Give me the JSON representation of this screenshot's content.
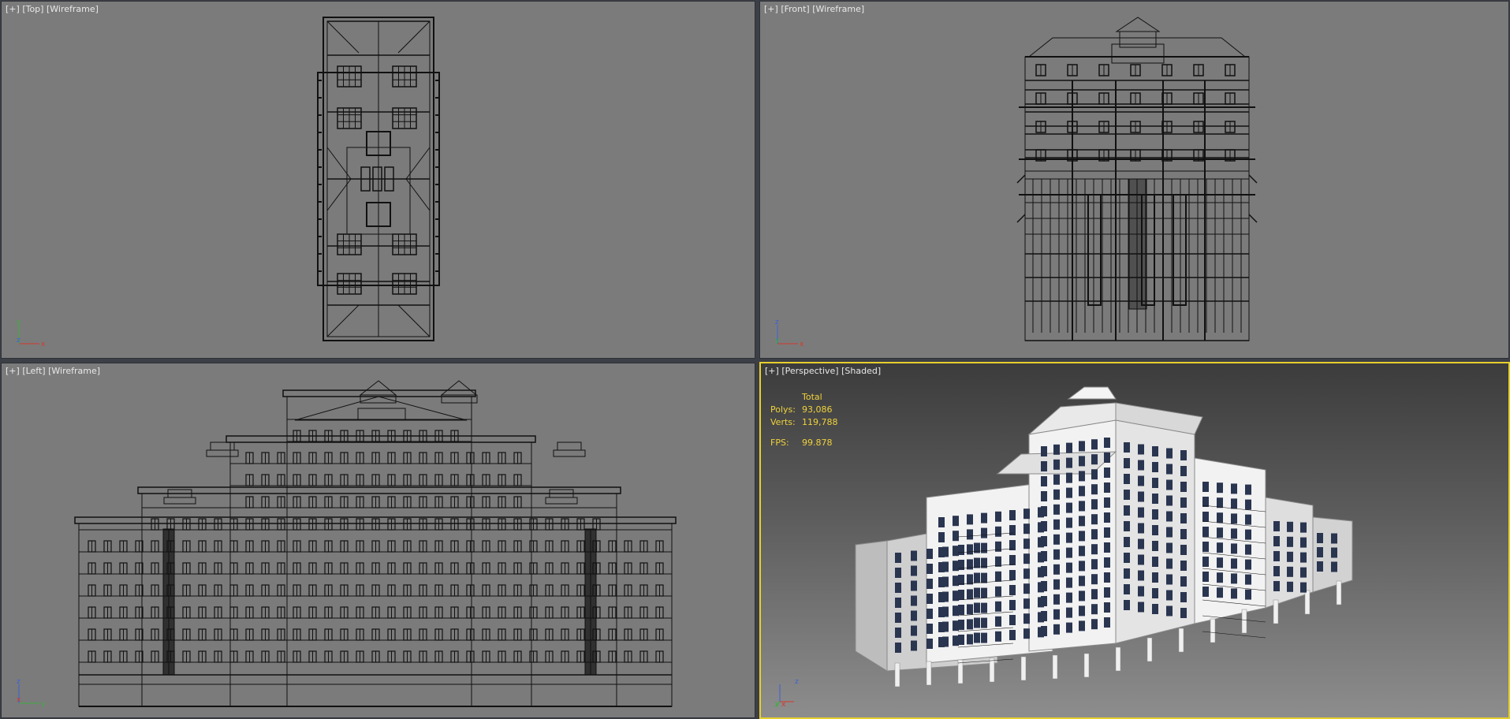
{
  "viewports": {
    "top": {
      "plus": "[+]",
      "view": "[Top]",
      "mode": "[Wireframe]",
      "axis_h": "x",
      "axis_v": "y",
      "axis_d": "z"
    },
    "front": {
      "plus": "[+]",
      "view": "[Front]",
      "mode": "[Wireframe]",
      "axis_h": "x",
      "axis_v": "z",
      "axis_d": "y"
    },
    "left": {
      "plus": "[+]",
      "view": "[Left]",
      "mode": "[Wireframe]",
      "axis_h": "y",
      "axis_v": "z",
      "axis_d": "x"
    },
    "perspective": {
      "plus": "[+]",
      "view": "[Perspective]",
      "mode": "[Shaded]",
      "axis_h": "x",
      "axis_v": "z",
      "axis_d": "y",
      "stats": {
        "header": "Total",
        "polys_label": "Polys:",
        "polys_value": "93,086",
        "verts_label": "Verts:",
        "verts_value": "119,788",
        "fps_label": "FPS:",
        "fps_value": "99.878"
      }
    }
  },
  "colors": {
    "wire_bg": "#7b7b7b",
    "wire_line": "#111111",
    "active_border": "#e6cf2b",
    "stats_text": "#f0d23c",
    "axis_x": "#d23a2a",
    "axis_y": "#3fae3f",
    "axis_z": "#3c5fd8",
    "wall": "#f2f2f2",
    "window": "#2a3550"
  }
}
